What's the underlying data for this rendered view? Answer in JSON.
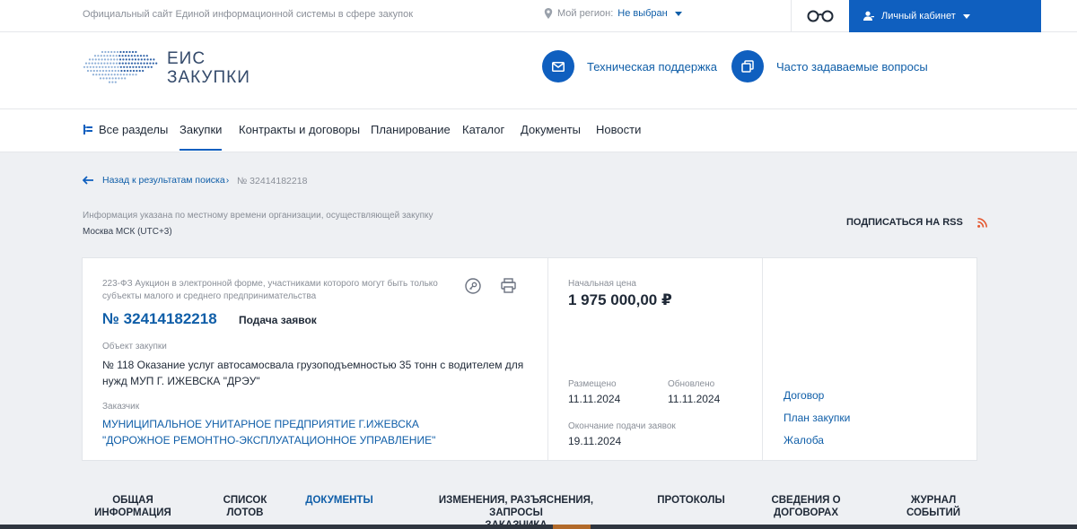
{
  "topbar": {
    "site_description": "Официальный сайт Единой информационной системы в сфере закупок",
    "region_label": "Мой регион:",
    "region_value": "Не выбран",
    "cabinet_label": "Личный кабинет"
  },
  "header": {
    "logo_line1": "ЕИС",
    "logo_line2": "ЗАКУПКИ",
    "support_label": "Техническая поддержка",
    "faq_label": "Часто задаваемые вопросы"
  },
  "nav": {
    "all_sections": "Все разделы",
    "items": [
      "Закупки",
      "Контракты и договоры",
      "Планирование",
      "Каталог",
      "Документы",
      "Новости"
    ]
  },
  "breadcrumb": {
    "back_label": "Назад к результатам поиска",
    "current": "№ 32414182218"
  },
  "timezone": {
    "note": "Информация указана по местному времени организации, осуществляющей закупку",
    "value": "Москва МСК (UTC+3)"
  },
  "rss_label": "ПОДПИСАТЬСЯ НА RSS",
  "procurement": {
    "type": "223-ФЗ Аукцион в электронной форме, участниками которого могут быть только субъекты малого и среднего предпринимательства",
    "number": "№ 32414182218",
    "stage": "Подача заявок",
    "object_label": "Объект закупки",
    "object_value": "№ 118 Оказание услуг автосамосвала грузоподъемностью 35 тонн с водителем для нужд МУП Г. ИЖЕВСКА \"ДРЭУ\"",
    "customer_label": "Заказчик",
    "customer_value": "МУНИЦИПАЛЬНОЕ УНИТАРНОЕ ПРЕДПРИЯТИЕ Г.ИЖЕВСКА \"ДОРОЖНОЕ РЕМОНТНО-ЭКСПЛУАТАЦИОННОЕ УПРАВЛЕНИЕ\"",
    "price_label": "Начальная цена",
    "price_value": "1 975 000,00 ₽",
    "posted_label": "Размещено",
    "posted_value": "11.11.2024",
    "updated_label": "Обновлено",
    "updated_value": "11.11.2024",
    "deadline_label": "Окончание подачи заявок",
    "deadline_value": "19.11.2024",
    "links": [
      "Договор",
      "План закупки",
      "Жалоба"
    ]
  },
  "tabs": [
    {
      "line1": "ОБЩАЯ",
      "line2": "ИНФОРМАЦИЯ"
    },
    {
      "line1": "СПИСОК",
      "line2": "ЛОТОВ"
    },
    {
      "line1": "ДОКУМЕНТЫ",
      "line2": ""
    },
    {
      "line1": "ИЗМЕНЕНИЯ, РАЗЪЯСНЕНИЯ, ЗАПРОСЫ",
      "line2": "ЗАКАЗЧИКА"
    },
    {
      "line1": "ПРОТОКОЛЫ",
      "line2": ""
    },
    {
      "line1": "СВЕДЕНИЯ О",
      "line2": "ДОГОВОРАХ"
    },
    {
      "line1": "ЖУРНАЛ",
      "line2": "СОБЫТИЙ"
    }
  ],
  "colors": {
    "accent": "#0f5fbf",
    "link": "#0f5ea8",
    "rss": "#e4572e",
    "page_bg": "#eef0f3"
  }
}
